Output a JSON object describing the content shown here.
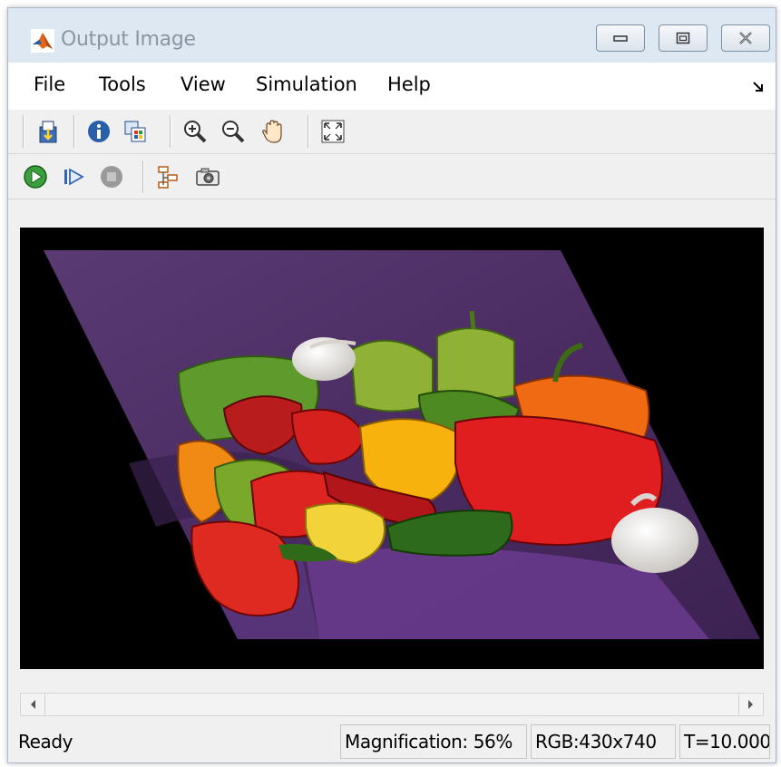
{
  "window": {
    "title": "Output Image"
  },
  "menu": [
    {
      "label": "File"
    },
    {
      "label": "Tools"
    },
    {
      "label": "View"
    },
    {
      "label": "Simulation"
    },
    {
      "label": "Help"
    }
  ],
  "toolbar1": [
    "print-to-figure-icon",
    "info-icon",
    "maintain-fit-icon",
    "zoom-in-icon",
    "zoom-out-icon",
    "pan-icon",
    "fit-to-view-icon"
  ],
  "toolbar2": [
    "run-icon",
    "step-forward-icon",
    "stop-icon",
    "highlight-model-icon",
    "snapshot-icon"
  ],
  "status": {
    "state": "Ready",
    "magnification": "Magnification: 56%",
    "dimensions": "RGB:430x740",
    "time": "T=10.000"
  },
  "colors": {
    "title_bar": "#dee8f3",
    "background": "#f0f0f0",
    "image_background": "#000000",
    "cloth": "#4a2c62"
  }
}
